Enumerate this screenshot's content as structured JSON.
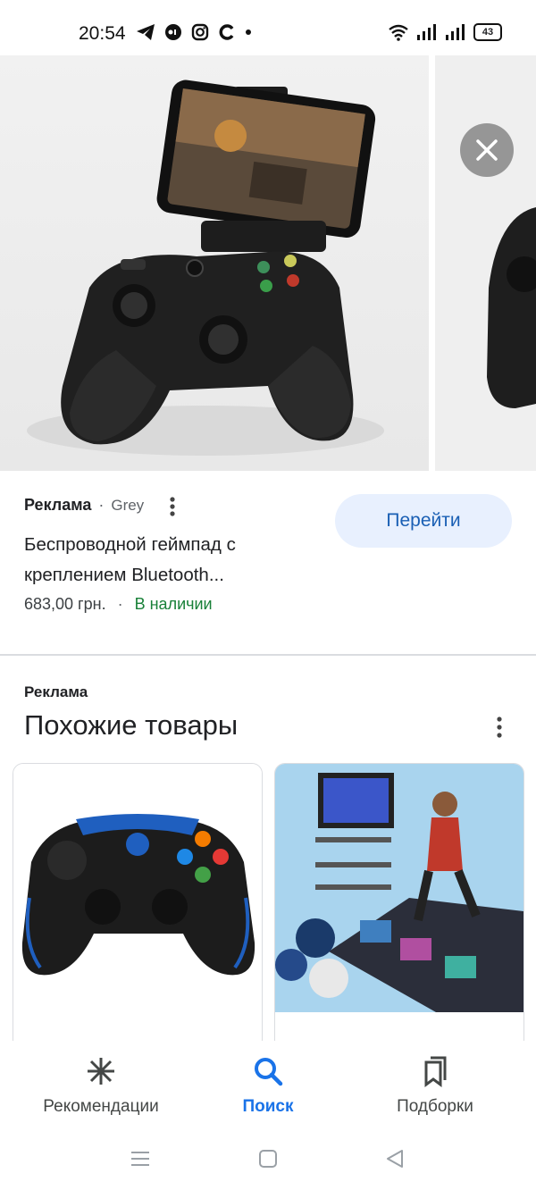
{
  "status_bar": {
    "time": "20:54",
    "battery": "43"
  },
  "ad": {
    "label": "Реклама",
    "source": "Grey",
    "title": "Беспроводной геймпад с креплением Bluetooth...",
    "price": "683,00 грн.",
    "availability": "В наличии",
    "cta": "Перейти"
  },
  "similar": {
    "ad_label": "Реклама",
    "title": "Похожие товары"
  },
  "nav": {
    "recommendations": "Рекомендации",
    "search": "Поиск",
    "collections": "Подборки"
  },
  "colors": {
    "accent": "#1a73e8",
    "cta_bg": "#e8f0fe",
    "stock": "#188038"
  }
}
